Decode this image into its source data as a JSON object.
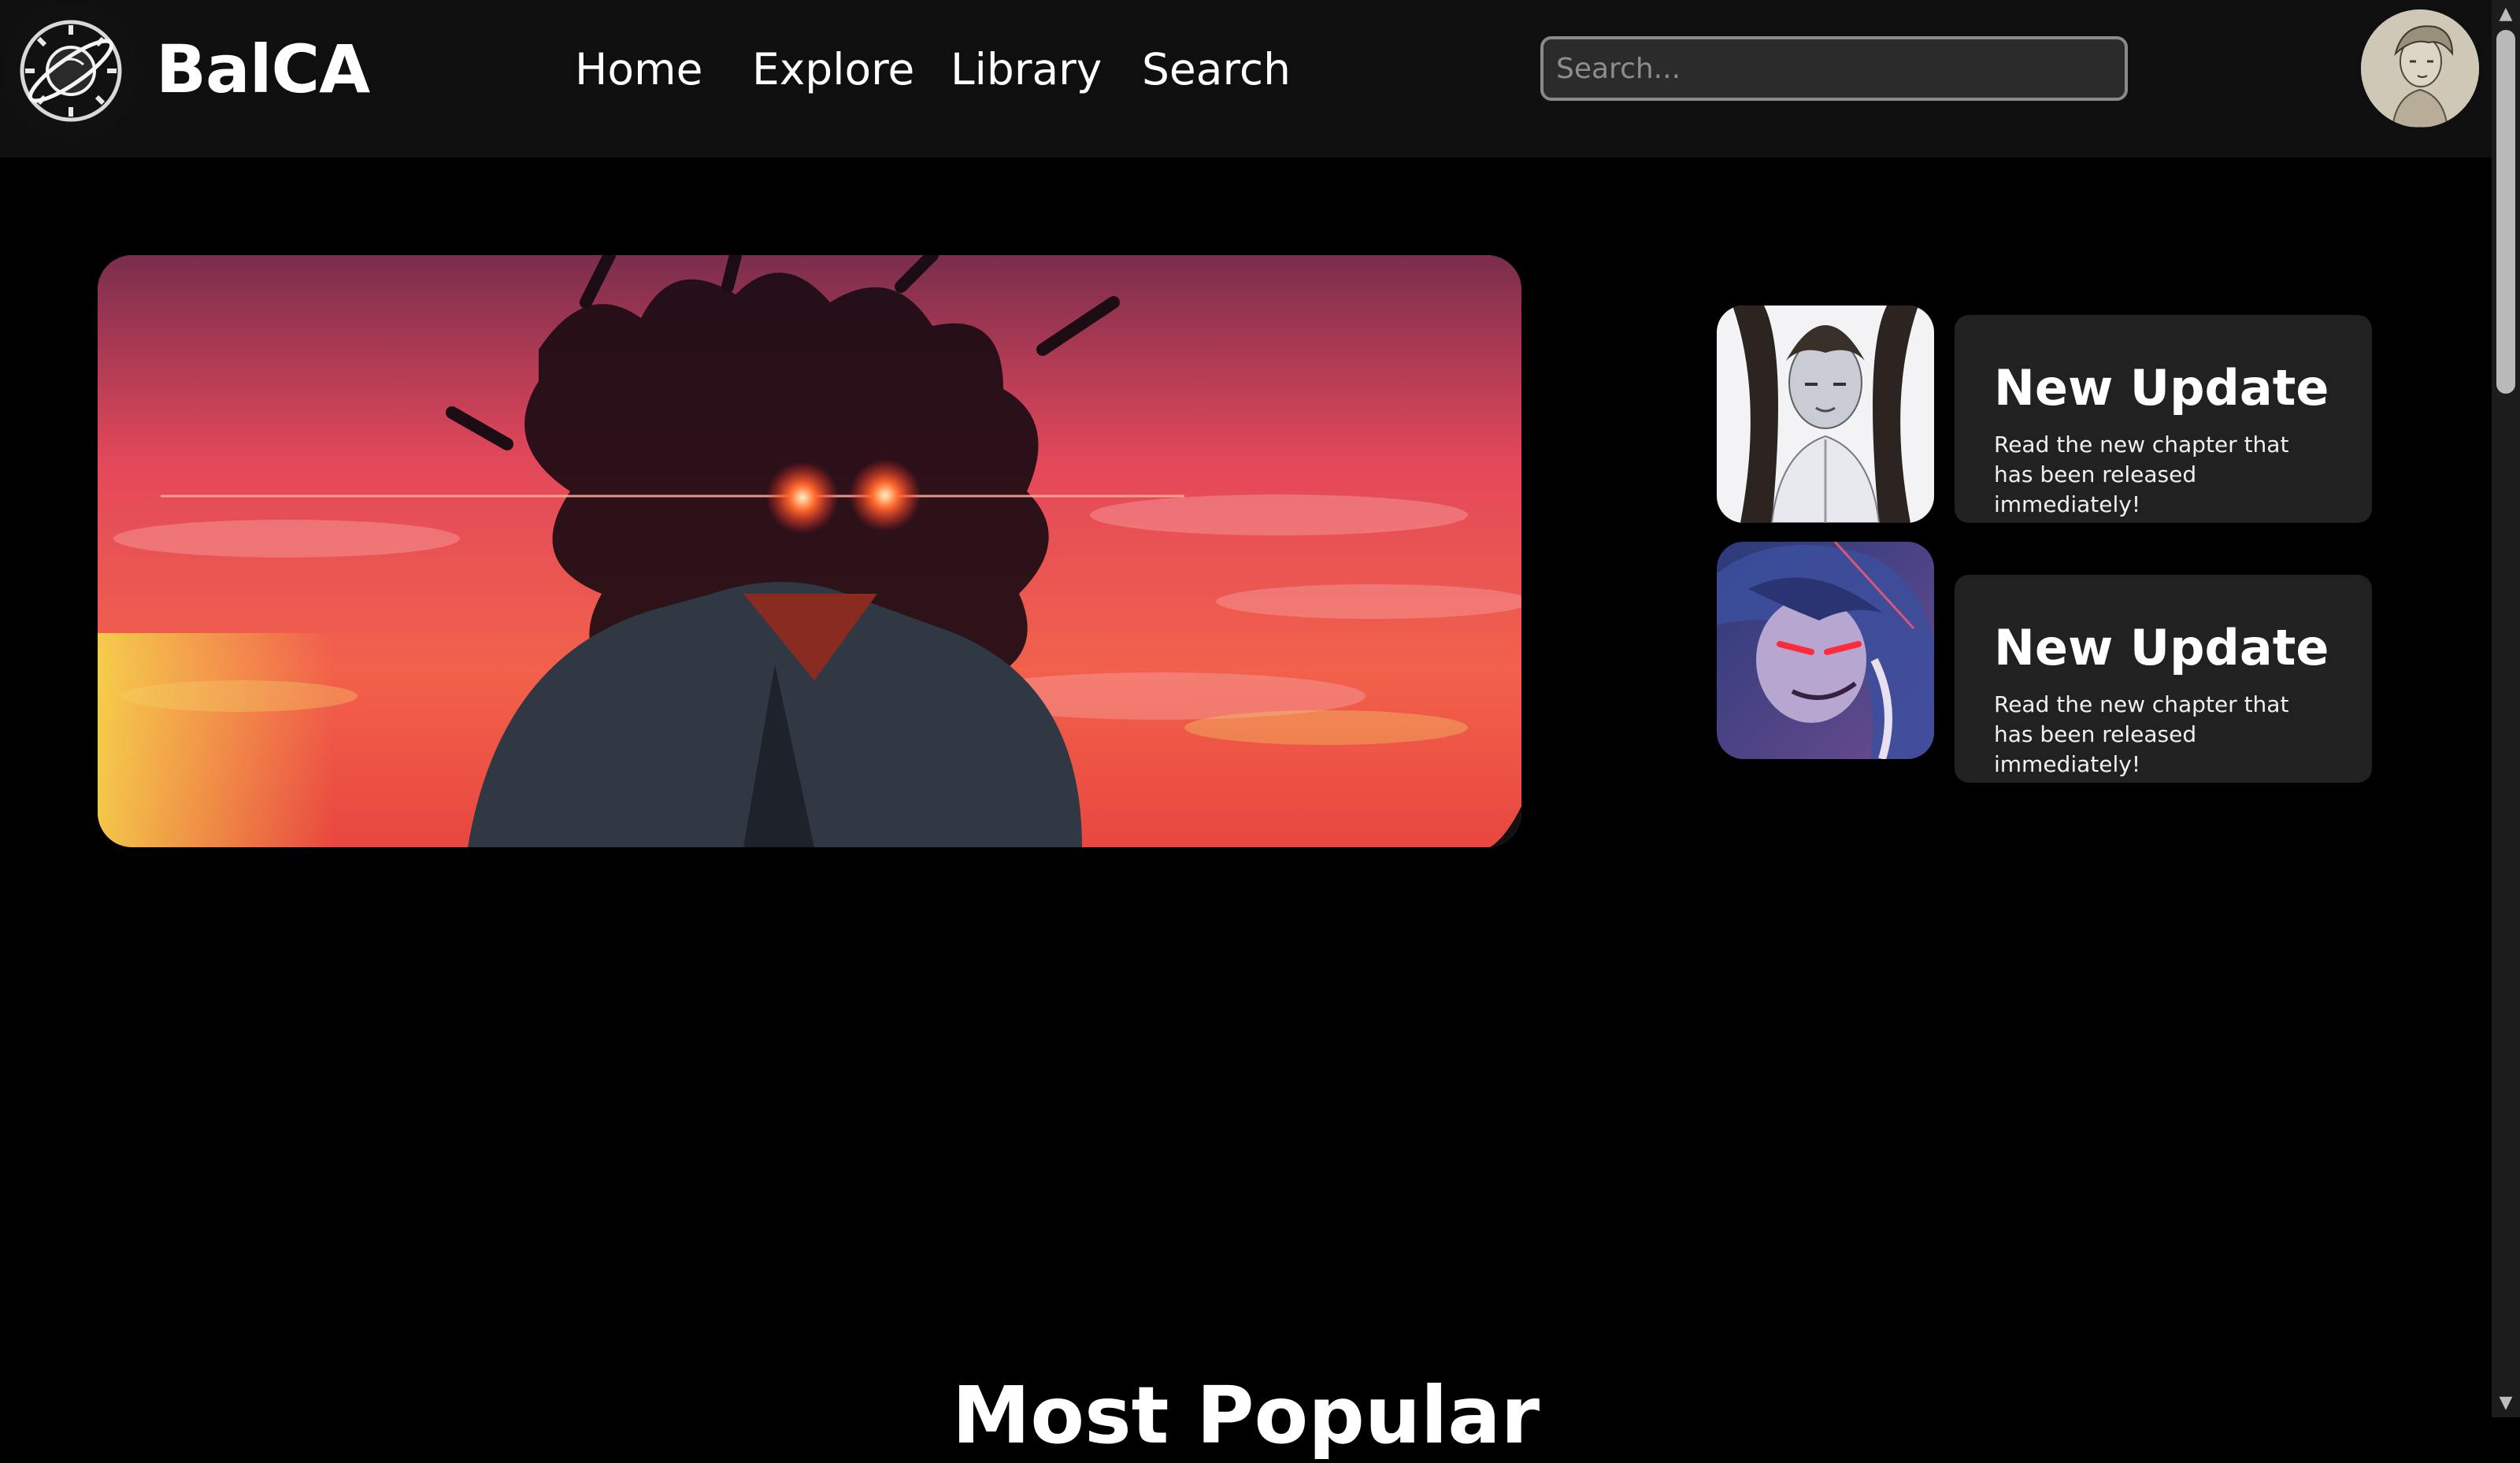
{
  "header": {
    "brand": "BalCA",
    "nav": [
      {
        "label": "Home"
      },
      {
        "label": "Explore"
      },
      {
        "label": "Library"
      },
      {
        "label": "Search"
      }
    ],
    "search": {
      "placeholder": "Search...",
      "value": ""
    }
  },
  "updates": [
    {
      "title": "New Update",
      "description": "Read the new chapter that has been released immediately!"
    },
    {
      "title": "New Update",
      "description": "Read the new chapter that has been released immediately!"
    }
  ],
  "sections": {
    "most_popular": "Most Popular"
  },
  "icons": {
    "logo": "planet-clock-logo",
    "avatar": "sketch-portrait",
    "scroll_up": "triangle-up-icon",
    "scroll_down": "triangle-down-icon"
  },
  "colors": {
    "background": "#000000",
    "header": "#0f0f0f",
    "card": "#212121",
    "text": "#ffffff"
  }
}
